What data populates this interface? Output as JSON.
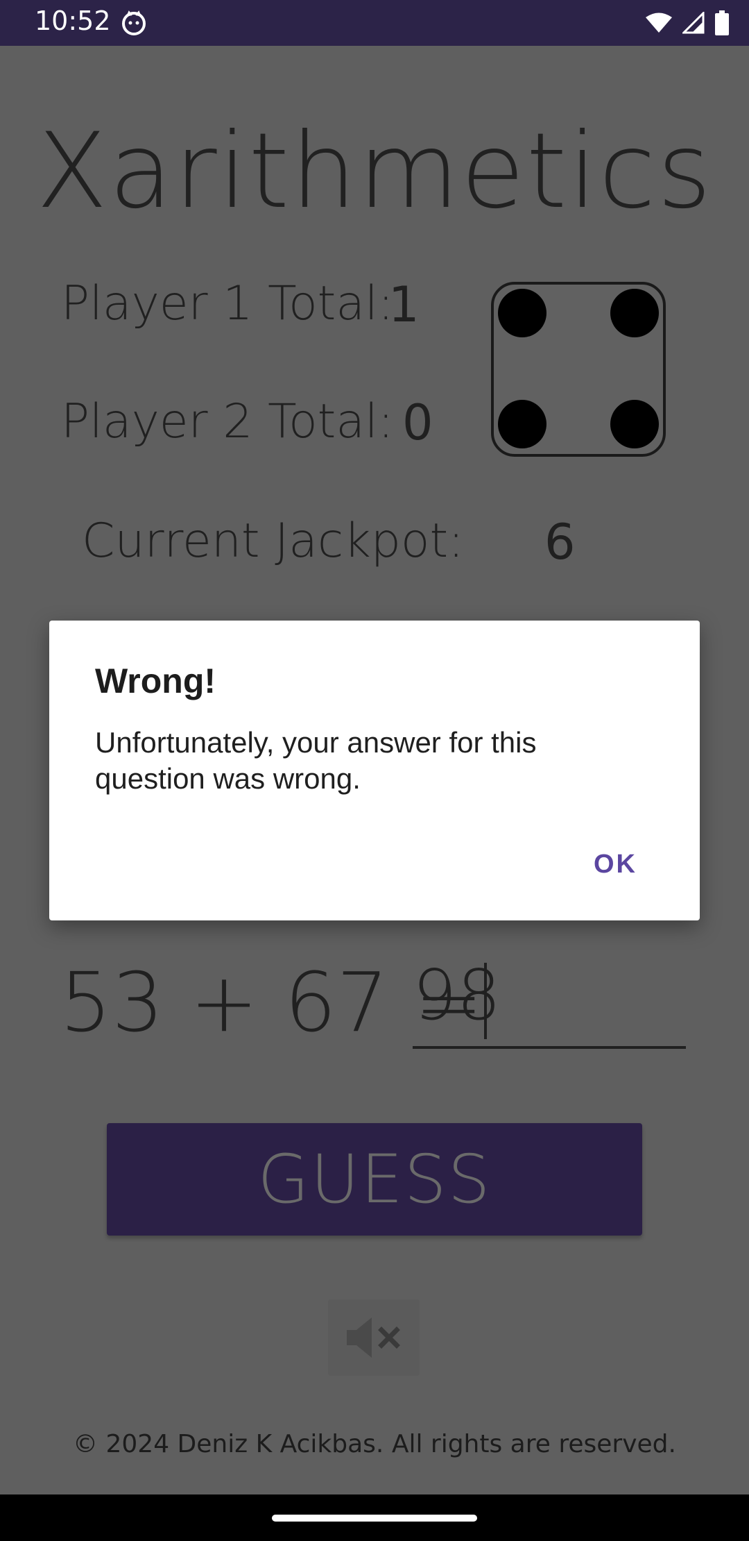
{
  "status_bar": {
    "time": "10:52",
    "icons": [
      "cat-icon",
      "wifi-icon",
      "signal-icon",
      "battery-icon"
    ]
  },
  "app": {
    "title": "Xarithmetics",
    "player1_label": "Player 1 Total:",
    "player1_value": "1",
    "player2_label": "Player 2 Total:",
    "player2_value": "0",
    "jackpot_label": "Current Jackpot:",
    "jackpot_value": "6",
    "die_face": 4,
    "equation": "53 + 67 =",
    "answer_value": "98",
    "guess_label": "GUESS",
    "mute_icon": "volume-muted-icon",
    "copyright": "© 2024 Deniz K Acikbas. All rights are reserved."
  },
  "dialog": {
    "title": "Wrong!",
    "message": "Unfortunately, your answer for this question was wrong.",
    "ok_label": "OK"
  },
  "colors": {
    "statusbar": "#2c2348",
    "scrim_background": "#5f5f5f",
    "guess_button": "#2b2046",
    "dialog_accent": "#5b46a0"
  }
}
